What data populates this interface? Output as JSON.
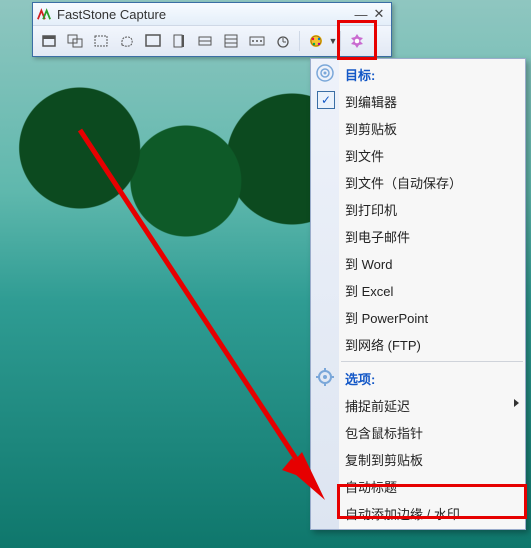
{
  "app": {
    "title": "FastStone Capture"
  },
  "toolbar_icons": [
    "capture-active-window",
    "capture-window-object",
    "capture-rect",
    "capture-freehand",
    "capture-fullscreen",
    "capture-scrolling",
    "capture-fixed",
    "capture-repeat-last",
    "screen-recorder",
    "delay"
  ],
  "menu": {
    "target_header": "目标:",
    "options_header": "选项:",
    "targets": [
      {
        "label": "到编辑器",
        "checked": true
      },
      {
        "label": "到剪贴板"
      },
      {
        "label": "到文件"
      },
      {
        "label": "到文件（自动保存）"
      },
      {
        "label": "到打印机"
      },
      {
        "label": "到电子邮件"
      },
      {
        "label": "到 Word"
      },
      {
        "label": "到 Excel"
      },
      {
        "label": "到 PowerPoint"
      },
      {
        "label": "到网络 (FTP)"
      }
    ],
    "options": [
      {
        "label": "捕捉前延迟",
        "submenu": true
      },
      {
        "label": "包含鼠标指针"
      },
      {
        "label": "复制到剪贴板"
      },
      {
        "label": "自动标题"
      },
      {
        "label": "自动添加边缘 / 水印"
      }
    ]
  }
}
